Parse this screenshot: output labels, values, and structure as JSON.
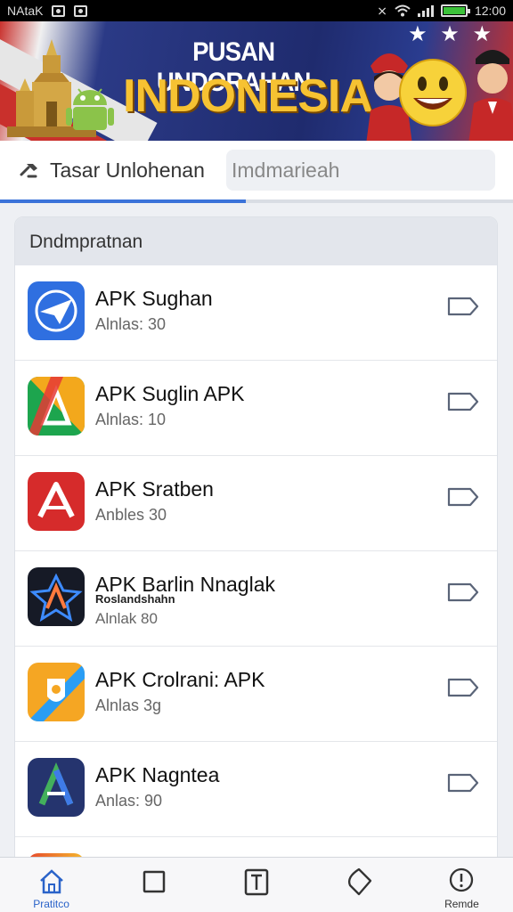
{
  "status_bar": {
    "carrier": "NAtaK",
    "time": "12:00"
  },
  "banner": {
    "title": "PUSAN UNDORAHAN",
    "subtitle": "INDONESIA",
    "stars": "★ ★ ★"
  },
  "search": {
    "tab_label": "Tasar Unlohenan",
    "placeholder": "Imdmarieah",
    "progress_fraction": 0.48
  },
  "list": {
    "header": "Dndmpratnan",
    "apps": [
      {
        "name": "APK Sughan",
        "extra": "",
        "count": "Alnlas: 30",
        "icon": "paper-plane-icon",
        "colors": [
          "#2f6fe0",
          "#5aa0ff"
        ]
      },
      {
        "name": "APK Suglin APK",
        "extra": "",
        "count": "Alnlas: 10",
        "icon": "triangle-multicolor-icon",
        "colors": [
          "#1da54e",
          "#f3a81c"
        ]
      },
      {
        "name": "APK Sratben",
        "extra": "",
        "count": "Anbles 30",
        "icon": "letter-a-red-icon",
        "colors": [
          "#d62b2b",
          "#e84a4a"
        ]
      },
      {
        "name": "APK Barlin Nnaglak",
        "extra": "Roslandshahn",
        "count": "Alnlak 80",
        "icon": "star-a-dark-icon",
        "colors": [
          "#161a26",
          "#2b3145"
        ]
      },
      {
        "name": "APK Crolrani: APK",
        "extra": "",
        "count": "Alnlas 3g",
        "icon": "shield-orange-icon",
        "colors": [
          "#f5a623",
          "#2a9df4"
        ]
      },
      {
        "name": "APK Nagntea",
        "extra": "",
        "count": "Anlas: 90",
        "icon": "letter-a-navy-icon",
        "colors": [
          "#25346e",
          "#3a4c94"
        ]
      }
    ]
  },
  "nav": {
    "items": [
      {
        "label": "Pratitco",
        "icon": "home-icon",
        "active": true
      },
      {
        "label": "",
        "icon": "square-icon",
        "active": false
      },
      {
        "label": "",
        "icon": "text-box-icon",
        "active": false
      },
      {
        "label": "",
        "icon": "tag-icon",
        "active": false
      },
      {
        "label": "Remde",
        "icon": "alert-circle-icon",
        "active": false
      }
    ]
  },
  "colors": {
    "accent": "#3b73d9",
    "banner_blue": "#1f2b6e",
    "banner_gold": "#f6c232"
  }
}
